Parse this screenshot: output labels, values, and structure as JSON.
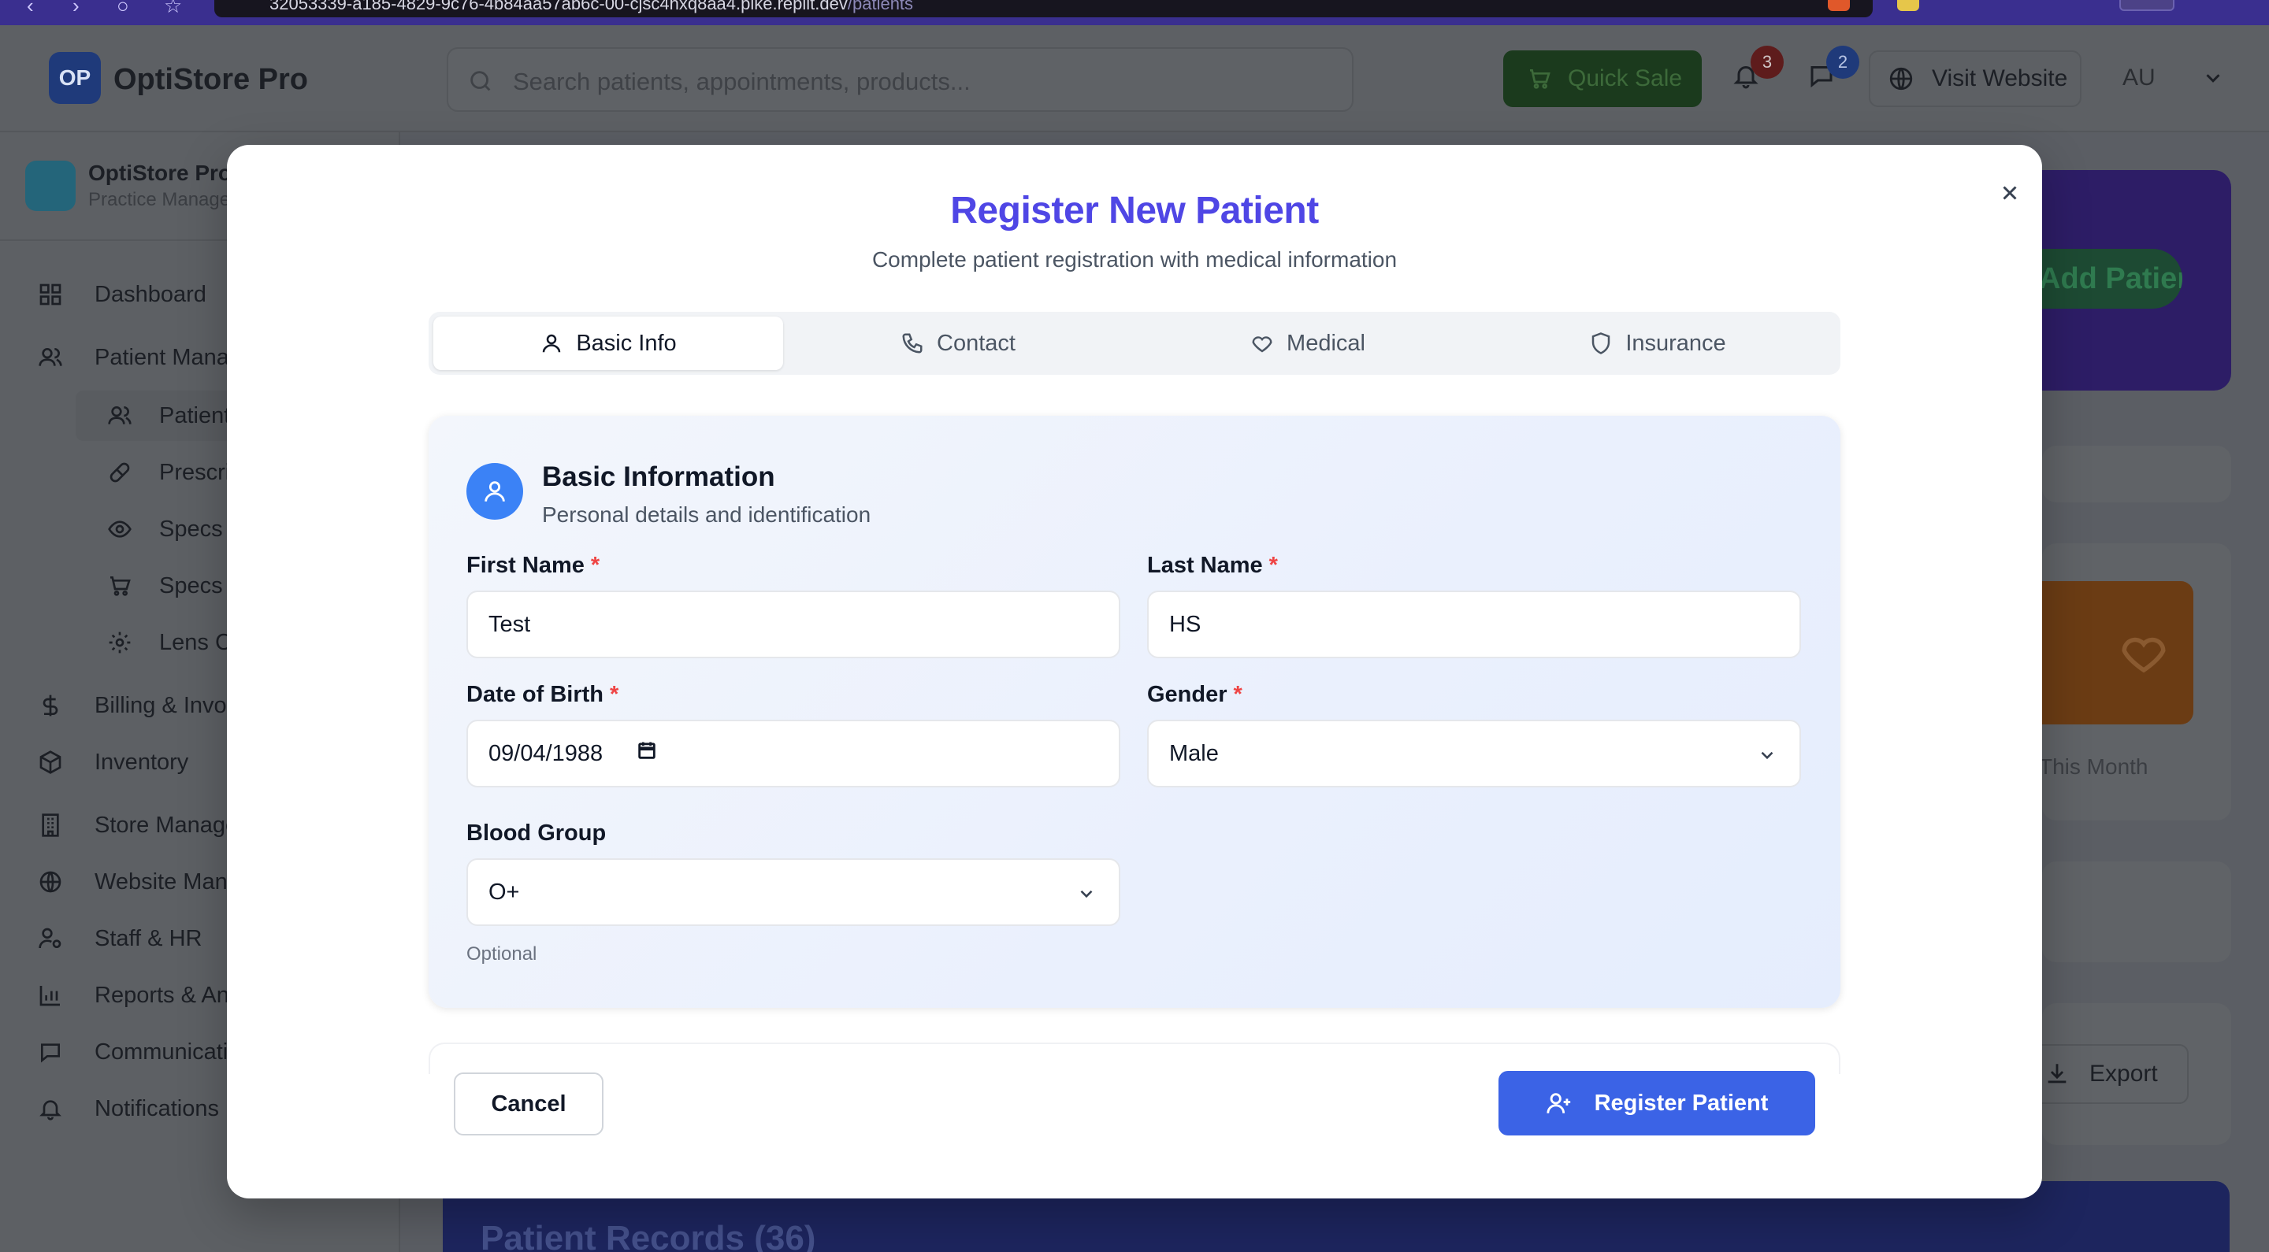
{
  "browser": {
    "url_host": "32053339-a185-4829-9c76-4b84aa57ab6c-00-cjsc4hxq8aa4.pike.replit.dev",
    "url_path": "/patients"
  },
  "header": {
    "logo_initials": "OP",
    "app_name": "OptiStore Pro",
    "search_placeholder": "Search patients, appointments, products...",
    "quick_sale_label": "Quick Sale",
    "notifications_count": "3",
    "messages_count": "2",
    "visit_website_label": "Visit Website",
    "user_initials": "AU"
  },
  "sidebar": {
    "brand_name": "OptiStore Pro",
    "brand_subtitle": "Practice Management",
    "items": [
      {
        "label": "Dashboard",
        "icon": "grid-icon"
      },
      {
        "label": "Patient Management",
        "icon": "users-icon"
      },
      {
        "label": "Patients",
        "icon": "users-icon"
      },
      {
        "label": "Prescriptions",
        "icon": "pill-icon"
      },
      {
        "label": "Specs Orders",
        "icon": "eye-icon"
      },
      {
        "label": "Specs Store",
        "icon": "cart-icon"
      },
      {
        "label": "Lens Catalog",
        "icon": "gear-icon"
      },
      {
        "label": "Billing & Invoicing",
        "icon": "dollar-icon"
      },
      {
        "label": "Inventory",
        "icon": "package-icon"
      },
      {
        "label": "Store Management",
        "icon": "building-icon"
      },
      {
        "label": "Website Management",
        "icon": "globe-icon"
      },
      {
        "label": "Staff & HR",
        "icon": "user-cog-icon"
      },
      {
        "label": "Reports & Analytics",
        "icon": "bar-chart-icon"
      },
      {
        "label": "Communication",
        "icon": "message-icon"
      },
      {
        "label": "Notifications",
        "icon": "bell-icon"
      }
    ]
  },
  "background": {
    "add_patient_label": "Add Patient",
    "month_fragment": "This Month",
    "export_label": "Export",
    "records_title": "Patient Records (36)"
  },
  "modal": {
    "title": "Register New Patient",
    "subtitle": "Complete patient registration with medical information",
    "tabs": [
      {
        "label": "Basic Info",
        "icon": "user-icon",
        "active": true
      },
      {
        "label": "Contact",
        "icon": "phone-icon",
        "active": false
      },
      {
        "label": "Medical",
        "icon": "heart-icon",
        "active": false
      },
      {
        "label": "Insurance",
        "icon": "shield-icon",
        "active": false
      }
    ],
    "section": {
      "heading": "Basic Information",
      "subheading": "Personal details and identification"
    },
    "fields": {
      "first_name": {
        "label": "First Name",
        "required": "*",
        "value": "Test"
      },
      "last_name": {
        "label": "Last Name",
        "required": "*",
        "value": "HS"
      },
      "dob": {
        "label": "Date of Birth",
        "required": "*",
        "value": "09/04/1988"
      },
      "gender": {
        "label": "Gender",
        "required": "*",
        "value": "Male"
      },
      "blood_group": {
        "label": "Blood Group",
        "value": "O+",
        "hint": "Optional"
      }
    },
    "cancel_label": "Cancel",
    "submit_label": "Register Patient"
  },
  "colors": {
    "accent": "#4f46e5",
    "primary_button": "#3b63e6",
    "required": "#ef4444",
    "section_icon": "#3b82f6"
  }
}
